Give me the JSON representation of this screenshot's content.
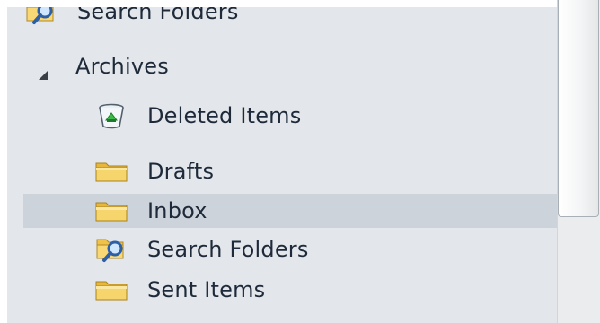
{
  "folder_pane": {
    "top_item": {
      "label": "Search Folders",
      "icon": "search-folder-icon"
    },
    "group": {
      "label": "Archives",
      "expanded": true,
      "arrow_icon": "expanded-triangle-icon"
    },
    "items": [
      {
        "label": "Deleted Items",
        "icon": "recycle-bin-icon"
      },
      {
        "label": "Drafts",
        "icon": "folder-icon"
      },
      {
        "label": "Inbox",
        "icon": "folder-icon",
        "selected": true
      },
      {
        "label": "Search Folders",
        "icon": "search-folder-icon"
      },
      {
        "label": "Sent Items",
        "icon": "folder-icon"
      }
    ]
  },
  "colors": {
    "pane_background": "#e3e6ea",
    "selected_row": "#cdd3db",
    "folder_yellow": "#f3c84f",
    "text": "#1e2a3a"
  }
}
